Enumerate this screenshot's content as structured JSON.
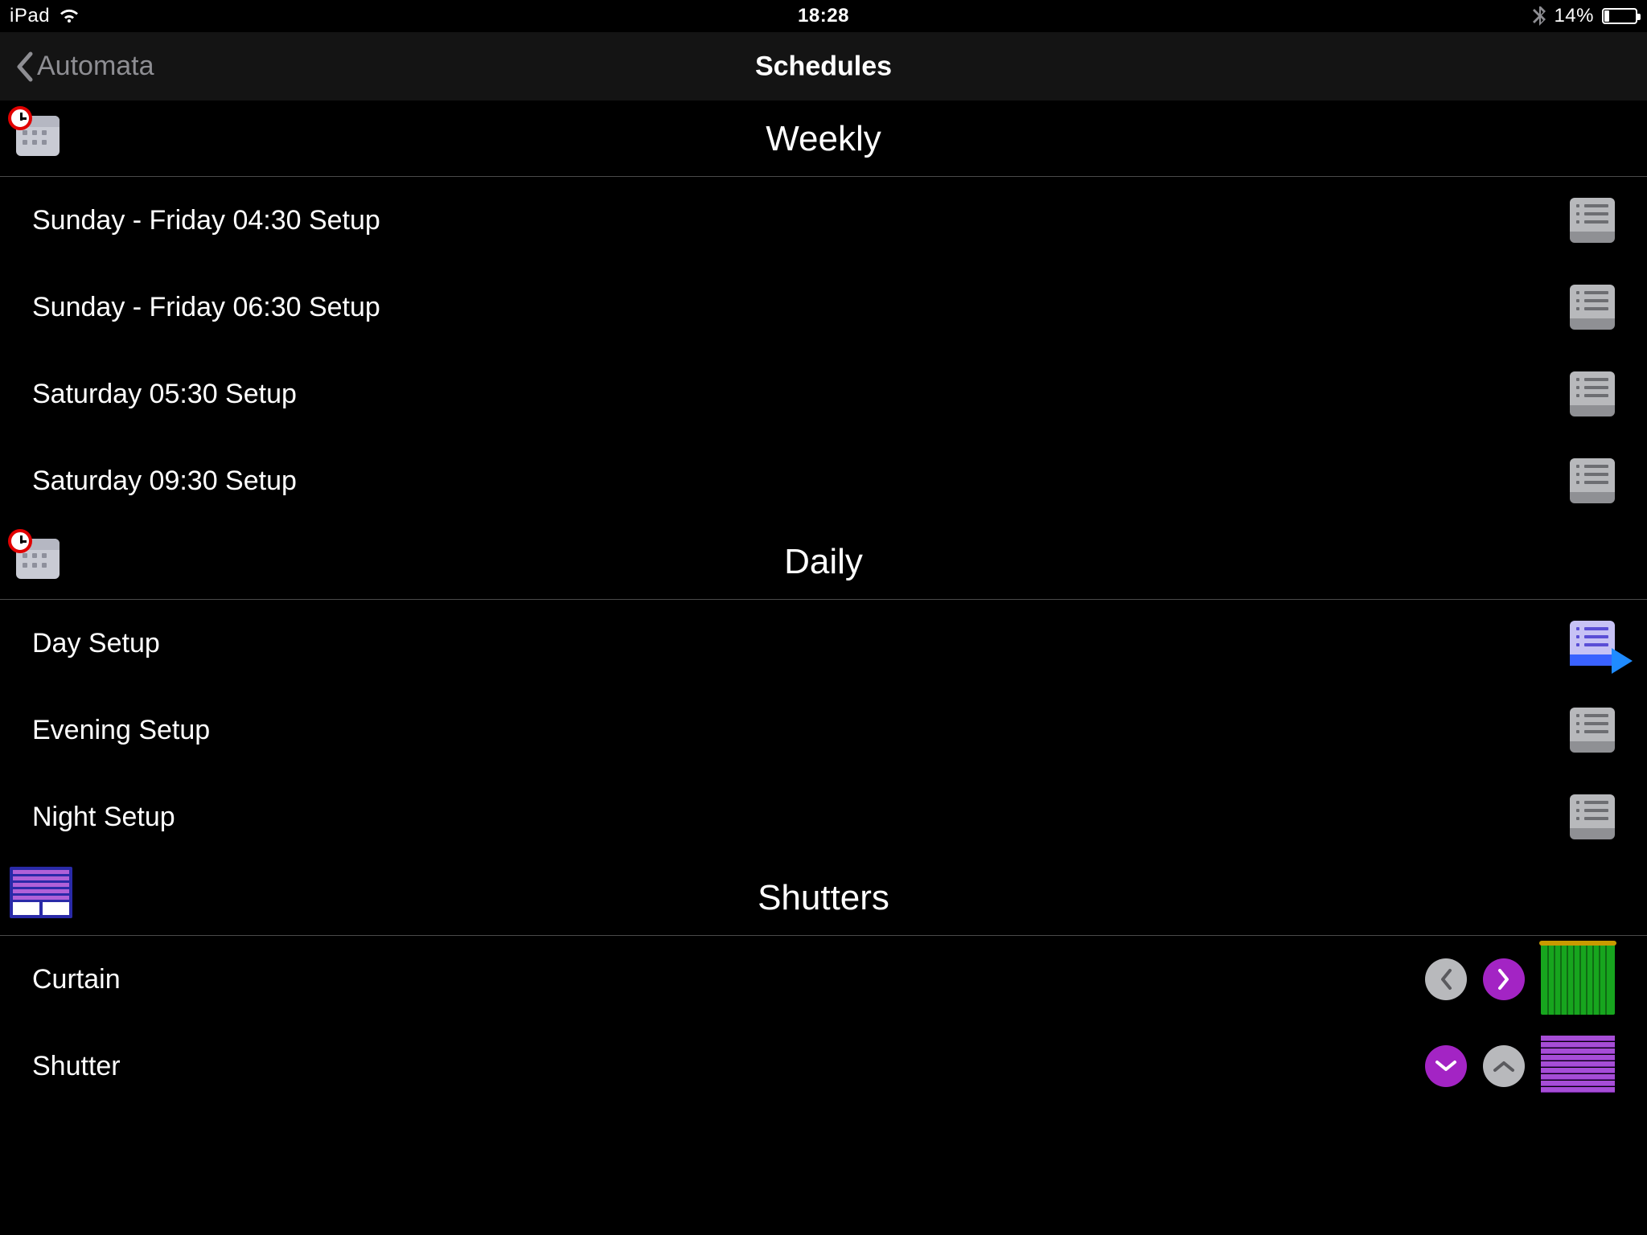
{
  "status": {
    "device": "iPad",
    "time": "18:28",
    "battery_pct": "14%"
  },
  "nav": {
    "back": "Automata",
    "title": "Schedules"
  },
  "sections": [
    {
      "key": "weekly",
      "title": "Weekly",
      "icon": "calendar-clock",
      "rows": [
        {
          "label": "Sunday - Friday 04:30 Setup",
          "right": "list"
        },
        {
          "label": "Sunday - Friday 06:30 Setup",
          "right": "list"
        },
        {
          "label": "Saturday 05:30 Setup",
          "right": "list"
        },
        {
          "label": "Saturday 09:30 Setup",
          "right": "list"
        }
      ]
    },
    {
      "key": "daily",
      "title": "Daily",
      "icon": "calendar-clock",
      "rows": [
        {
          "label": "Day Setup",
          "right": "list-active"
        },
        {
          "label": "Evening Setup",
          "right": "list"
        },
        {
          "label": "Night Setup",
          "right": "list"
        }
      ]
    },
    {
      "key": "shutters",
      "title": "Shutters",
      "icon": "shutter",
      "rows": [
        {
          "label": "Curtain",
          "right": "curtain-controls"
        },
        {
          "label": "Shutter",
          "right": "shutter-controls"
        }
      ]
    }
  ]
}
